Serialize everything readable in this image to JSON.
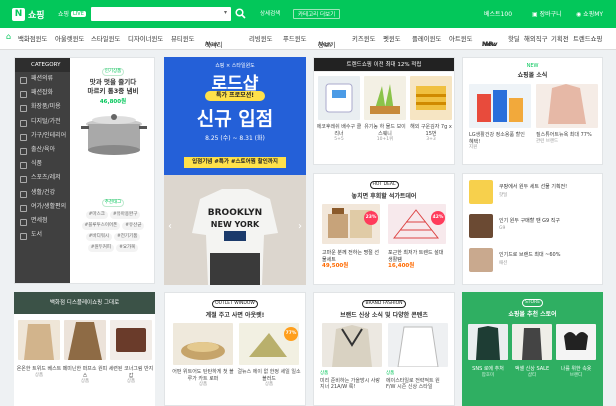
{
  "header": {
    "logo_text": "쇼핑",
    "live_label": "쇼핑",
    "live_badge": "LIVE",
    "search_placeholder": "",
    "btn_detail": "상세검색",
    "btn_category": "카테고리 더보기",
    "right_hint": "",
    "best100": "베스트100",
    "cart": "장바구니",
    "myshop": "쇼핑MY"
  },
  "nav": {
    "items": [
      "백화점윈도",
      "아울렛윈도",
      "스타일윈도",
      "디자이너윈도",
      "뷰티윈도",
      "럭셔리",
      "리빙윈도",
      "푸드윈도",
      "장보기",
      "키즈윈도",
      "펫윈도",
      "플레이윈도",
      "아트윈도"
    ],
    "new_badge": "New",
    "right_items": [
      "MR.",
      "핫딜",
      "해외직구",
      "기획전",
      "트렌드쇼핑"
    ]
  },
  "category": {
    "header": "CATEGORY",
    "items": [
      "패션의류",
      "패션잡화",
      "화장품/미용",
      "디지털/가전",
      "가구/인테리어",
      "출산/육아",
      "식품",
      "스포츠/레저",
      "생활/건강",
      "여가/생활편의",
      "면세점",
      "도서"
    ]
  },
  "side_promo": {
    "tag": "인기상품",
    "title1": "맛과 멋을 즐기다",
    "title2": "마르키 통3중 냄비",
    "price": "46,800원",
    "rec_tag": "추천태그",
    "tags": [
      "#마스크",
      "#유아용완구",
      "#블루투스이어폰",
      "#유산균",
      "#바디워시",
      "#전기기품",
      "#원두커피",
      "#요가복"
    ]
  },
  "banner": {
    "brand": "쇼핑 × 스타일윈도",
    "big1": "로드샵",
    "pill": "특가 프로모션!",
    "big2": "신규 입점",
    "date": "8.25 (수) ~ 8.31 (화)",
    "foot": "입점기념 #특가 #스토어찜 할인까지",
    "tee_text": "BROOKLYN NEW YORK"
  },
  "trend": {
    "title": "트렌드쇼핑 이전 최대 12% 적립",
    "items": [
      {
        "cap": "에코후레쉬 배수구 클리너",
        "sub": "5+5"
      },
      {
        "cap": "유기농 하 물드 보이스웨니",
        "sub": "10+1위"
      },
      {
        "cap": "해외 구운김자 7g x 15번",
        "sub": "3+3"
      }
    ]
  },
  "news": {
    "title": "쇼핑몰 소식",
    "items": [
      {
        "cap": "LG생활건강 정소용품 할인 혜택!",
        "sub": "지원"
      },
      {
        "cap": "질스튜어트뉴욕 최대 77%",
        "sub": "관련 브랜드"
      }
    ]
  },
  "hotdeal": {
    "tag": "HOT DEAL",
    "title": "놓치면 후회할 석가트데어",
    "items": [
      {
        "cap": "고마운 분께 전하는 명절 선물세트",
        "price": "49,500원",
        "badge": "23%"
      },
      {
        "cap": "포근한 최저가 트렌드 설대 생활템",
        "price": "16,400원",
        "badge": "42%"
      }
    ]
  },
  "notice": {
    "items": [
      {
        "cap": "쿠팡에서 원두 세트 선물 기획전!",
        "sub": "핫딜"
      },
      {
        "cap": "인기 원두 구매할 땐 G9 직구",
        "sub": "G9"
      },
      {
        "cap": "인기드로 브랜드 최대 ~60%",
        "sub": "패션"
      }
    ]
  },
  "dept": {
    "title": "백화점 디스플레이쇼핑 그대로",
    "items": [
      {
        "cap": "온온한 트위드 베스트",
        "sub": "상품"
      },
      {
        "cap": "페미닌한 퍼프소 원피스",
        "sub": "상품"
      },
      {
        "cap": "세련된 코너그림 반지갑",
        "sub": "상품"
      }
    ]
  },
  "outlet": {
    "tag": "OUTLET WINDOW",
    "title": "계절 주고 사면 아웃렛!",
    "items": [
      {
        "cap": "어떤 위트어도 탄탄하게 첫 블루가 카트 로퍼",
        "sub": "상품"
      },
      {
        "cap": "걸뉴스 에이 없 한정 세일 일소 블러드",
        "sub": "상품",
        "badge": "77%"
      }
    ]
  },
  "brand": {
    "tag": "BRAND FASHION",
    "title": "브랜드 신상 소식 및 다양한 콘텐츠",
    "items": [
      {
        "cap": "미리 준비하는 가을방시 사랑 지너 21A/W 룩!",
        "sub": "상품"
      },
      {
        "cap": "에이스타일로 전략적트 원 F/W 시즌 신상 스타일",
        "sub": "상품"
      }
    ]
  },
  "store": {
    "tag": "STORE",
    "title": "쇼핑몰 추천 스토어",
    "items": [
      {
        "cap": "SNS 로에 추처",
        "sub": "팜호미"
      },
      {
        "cap": "액셀 신상 SALE",
        "sub": "샵티"
      },
      {
        "cap": "나를 위한 속옷",
        "sub": "브랜디"
      }
    ]
  },
  "colors": {
    "brand_green": "#03c75a",
    "banner_blue": "#2460d8",
    "accent_yellow": "#ffe14a",
    "sale_red": "#ff3b5b"
  }
}
